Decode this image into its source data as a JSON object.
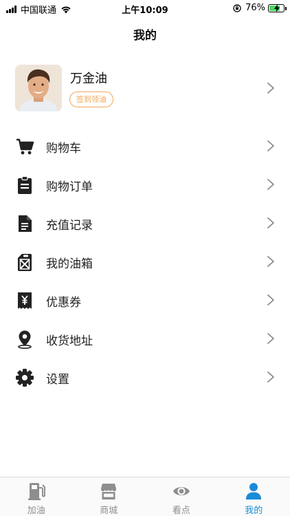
{
  "status_bar": {
    "carrier": "中国联通",
    "time": "上午10:09",
    "battery": "76%",
    "battery_level": 0.76,
    "battery_color": "#4cd964"
  },
  "header": {
    "title": "我的"
  },
  "profile": {
    "name": "万金油",
    "checkin_label": "签到领油",
    "checkin_color": "#f0a65a",
    "avatar_icon": "user-avatar-photo"
  },
  "menu": [
    {
      "label": "购物车",
      "icon": "cart-icon"
    },
    {
      "label": "购物订单",
      "icon": "clipboard-icon"
    },
    {
      "label": "充值记录",
      "icon": "document-icon"
    },
    {
      "label": "我的油箱",
      "icon": "jerrycan-icon"
    },
    {
      "label": "优惠券",
      "icon": "coupon-icon"
    },
    {
      "label": "收货地址",
      "icon": "location-pin-icon"
    },
    {
      "label": "设置",
      "icon": "gear-icon"
    }
  ],
  "tab_bar": {
    "active_color": "#1a8bd8",
    "inactive_color": "#8e8e8e",
    "tabs": [
      {
        "label": "加油",
        "icon": "fuel-pump-icon",
        "active": false
      },
      {
        "label": "商城",
        "icon": "store-icon",
        "active": false
      },
      {
        "label": "看点",
        "icon": "eye-icon",
        "active": false
      },
      {
        "label": "我的",
        "icon": "user-icon",
        "active": true
      }
    ]
  }
}
